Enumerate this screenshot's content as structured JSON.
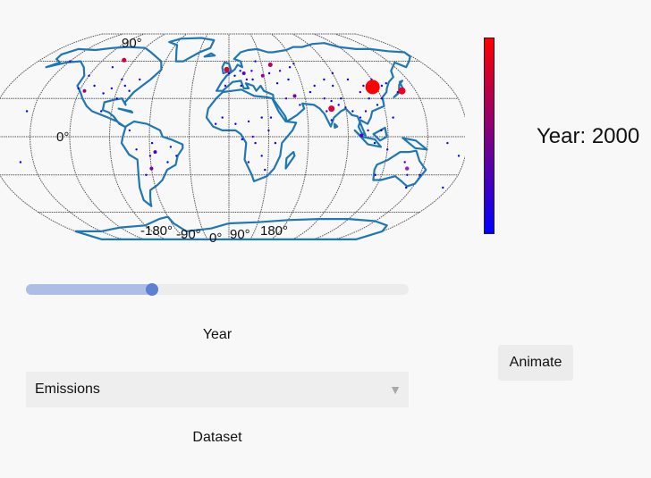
{
  "map": {
    "lat_label": "90°",
    "equator_label": "0°",
    "lon_labels": [
      "-180°",
      "-90°",
      "0°",
      "90°",
      "180°"
    ]
  },
  "colorbar": {
    "color_max": "#ff0000",
    "color_min": "#0000ff"
  },
  "year_title": "Year: 2000",
  "slider": {
    "fraction": 0.33
  },
  "year_label": "Year",
  "dataset": {
    "selected": "Emissions"
  },
  "dataset_label": "Dataset",
  "animate_button": "Animate",
  "colors": {
    "coastline": "#1f77b4",
    "graticule": "#555555"
  },
  "chart_data": {
    "type": "scatter",
    "projection": "robinson",
    "points": [
      {
        "lon": 117,
        "lat": 39,
        "size": 8,
        "color": "#ff0000"
      },
      {
        "lon": 139,
        "lat": 36,
        "size": 4,
        "color": "#ee0022"
      },
      {
        "lon": 79,
        "lat": 22,
        "size": 3.5,
        "color": "#dd0033"
      },
      {
        "lon": -2,
        "lat": 53,
        "size": 3,
        "color": "#dd0033"
      },
      {
        "lon": -100,
        "lat": 61,
        "size": 2.5,
        "color": "#cc0044"
      },
      {
        "lon": 38,
        "lat": 57,
        "size": 2.5,
        "color": "#bb0055"
      },
      {
        "lon": -116,
        "lat": 36,
        "size": 2,
        "color": "#aa0066"
      },
      {
        "lon": 29,
        "lat": 48,
        "size": 2,
        "color": "#9900aa"
      },
      {
        "lon": 13,
        "lat": 50,
        "size": 2,
        "color": "#6600cc"
      },
      {
        "lon": 52,
        "lat": 32,
        "size": 2,
        "color": "#7700aa"
      },
      {
        "lon": 138,
        "lat": -25,
        "size": 2.2,
        "color": "#9922aa"
      },
      {
        "lon": -60,
        "lat": -25,
        "size": 2,
        "color": "#7700aa"
      },
      {
        "lon": 100,
        "lat": 1,
        "size": 2,
        "color": "#5500cc"
      },
      {
        "lon": -56,
        "lat": -12,
        "size": 2,
        "color": "#4400dd"
      }
    ]
  }
}
